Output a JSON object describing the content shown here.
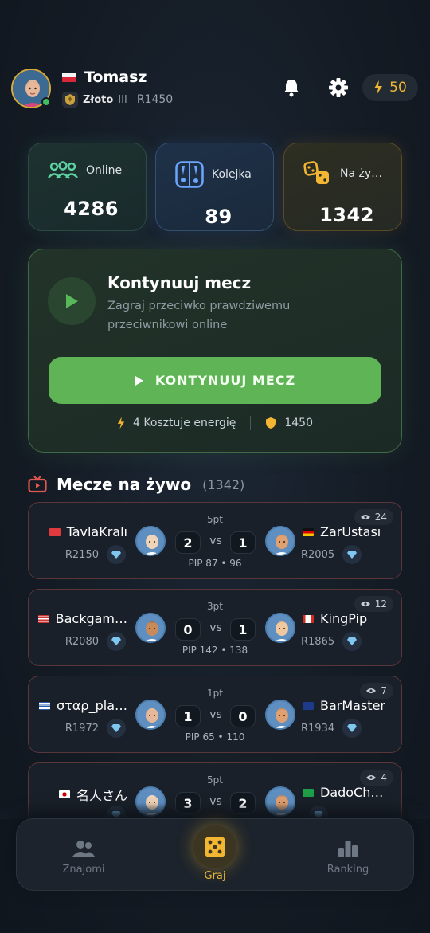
{
  "header": {
    "username": "Tomasz",
    "rank_name": "Złoto",
    "rank_tier": "III",
    "rating": "R1450",
    "energy": "50",
    "icons": [
      "bell-icon",
      "gear-icon",
      "lightning-icon"
    ]
  },
  "stats": {
    "online": {
      "label": "Online",
      "value": "4286",
      "icon": "users-icon"
    },
    "queue": {
      "label": "Kolejka",
      "value": "89",
      "icon": "board-icon"
    },
    "live": {
      "label": "Na ży…",
      "value": "1342",
      "icon": "dice-icon"
    }
  },
  "continue": {
    "title": "Kontynuuj mecz",
    "subtitle": "Zagraj przeciwko prawdziwemu przeciwnikowi online",
    "button_label": "KONTYNUUJ MECZ",
    "cost_label": "4 Kosztuje energię",
    "stake": "1450"
  },
  "live_section": {
    "title": "Mecze na żywo",
    "count": "(1342)"
  },
  "matches": [
    {
      "points": "5pt",
      "viewers": "24",
      "pip": "PIP 87 • 96",
      "left": {
        "name": "TavlaKralı",
        "rating": "R2150",
        "score": "2",
        "flag": "tr"
      },
      "vs": "vs",
      "right": {
        "name": "ZarUstası",
        "rating": "R2005",
        "score": "1",
        "flag": "de"
      }
    },
    {
      "points": "3pt",
      "viewers": "12",
      "pip": "PIP 142 • 138",
      "left": {
        "name": "Backgam…",
        "rating": "R2080",
        "score": "0",
        "flag": "us"
      },
      "vs": "vs",
      "right": {
        "name": "KingPip",
        "rating": "R1865",
        "score": "1",
        "flag": "ca"
      }
    },
    {
      "points": "1pt",
      "viewers": "7",
      "pip": "PIP 65 • 110",
      "left": {
        "name": "σταρ_pla…",
        "rating": "R1972",
        "score": "1",
        "flag": "gr"
      },
      "vs": "vs",
      "right": {
        "name": "BarMaster",
        "rating": "R1934",
        "score": "0",
        "flag": "gb"
      }
    },
    {
      "points": "5pt",
      "viewers": "4",
      "pip": "",
      "left": {
        "name": "名人さん",
        "rating": "",
        "score": "3",
        "flag": "jp"
      },
      "vs": "vs",
      "right": {
        "name": "DadoCh…",
        "rating": "",
        "score": "2",
        "flag": "br"
      }
    }
  ],
  "nav": {
    "friends": "Znajomi",
    "play": "Graj",
    "ranking": "Ranking"
  }
}
